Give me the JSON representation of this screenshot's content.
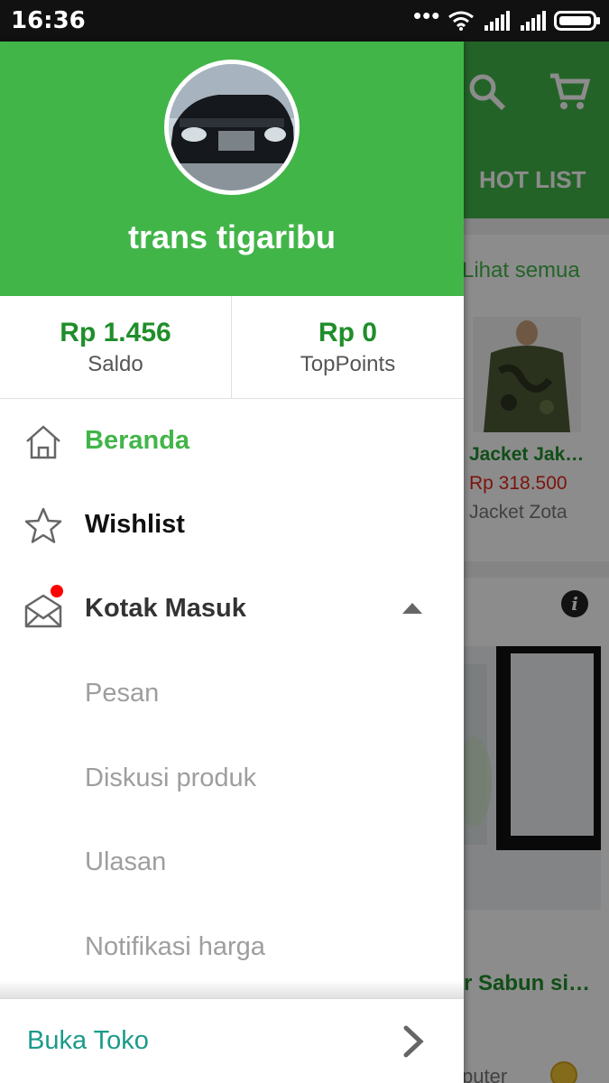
{
  "status_bar": {
    "time": "16:36",
    "icons": [
      "more-dots-icon",
      "wifi-icon",
      "signal-icon",
      "signal-icon",
      "battery-icon"
    ]
  },
  "background": {
    "toolbar_tab": "HOT LIST",
    "see_all": "Lihat semua",
    "product": {
      "name": "Jacket Jak…",
      "price": "Rp 318.500",
      "shop": "Jacket Zota"
    },
    "product2_name": "r Sabun si…",
    "shop2_partial": "puter"
  },
  "drawer": {
    "user_name": "trans tigaribu",
    "balances": [
      {
        "amount": "Rp 1.456",
        "label": "Saldo"
      },
      {
        "amount": "Rp 0",
        "label": "TopPoints"
      }
    ],
    "menu": [
      {
        "label": "Beranda",
        "icon": "home-icon",
        "color": "#42b549"
      },
      {
        "label": "Wishlist",
        "icon": "star-icon",
        "color": "#111111"
      },
      {
        "label": "Kotak Masuk",
        "icon": "mail-icon",
        "color": "#333333"
      }
    ],
    "submenu": [
      "Pesan",
      "Diskusi produk",
      "Ulasan",
      "Notifikasi harga"
    ],
    "footer_label": "Buka Toko"
  },
  "colors": {
    "primary": "#42b549",
    "price": "#e2231a",
    "footer_text": "#1b9a8a"
  }
}
